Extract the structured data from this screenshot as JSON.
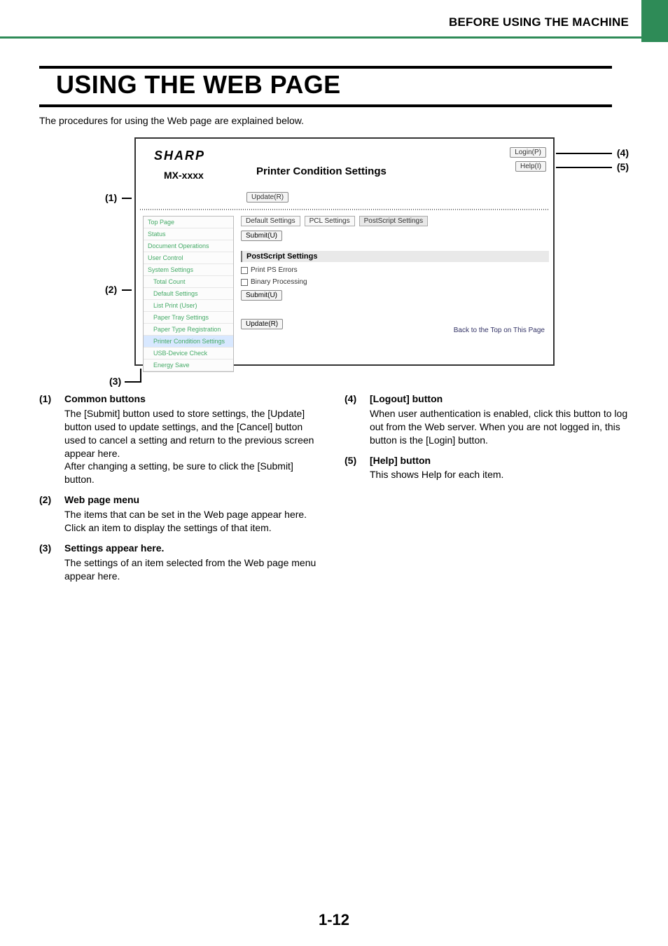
{
  "header": {
    "section": "BEFORE USING THE MACHINE"
  },
  "title": "USING THE WEB PAGE",
  "intro": "The procedures for using the Web page are explained below.",
  "callouts": {
    "c1": "(1)",
    "c2": "(2)",
    "c3": "(3)",
    "c4": "(4)",
    "c5": "(5)"
  },
  "figure": {
    "brand": "SHARP",
    "model": "MX-xxxx",
    "page_title": "Printer Condition Settings",
    "login_btn": "Login(P)",
    "help_btn": "Help(I)",
    "update_btn": "Update(R)",
    "nav": [
      "Top Page",
      "Status",
      "Document Operations",
      "User Control",
      "System Settings",
      "Total Count",
      "Default Settings",
      "List Print (User)",
      "Paper Tray Settings",
      "Paper Type Registration",
      "Printer Condition Settings",
      "USB-Device Check",
      "Energy Save"
    ],
    "tabs": {
      "t1": "Default Settings",
      "t2": "PCL Settings",
      "t3": "PostScript Settings"
    },
    "submit": "Submit(U)",
    "ps_header": "PostScript Settings",
    "opt1": "Print PS Errors",
    "opt2": "Binary Processing",
    "backtop": "Back to the Top on This Page"
  },
  "annotations": {
    "a1": {
      "num": "(1)",
      "title": "Common buttons",
      "body": "The [Submit] button used to store settings, the [Update] button used to update settings, and the [Cancel] button used to cancel a setting and return to the previous screen appear here.\nAfter changing a setting, be sure to click the [Submit] button."
    },
    "a2": {
      "num": "(2)",
      "title": "Web page menu",
      "body": "The items that can be set in the Web page appear here. Click an item to display the settings of that item."
    },
    "a3": {
      "num": "(3)",
      "title": "Settings appear here.",
      "body": "The settings of an item selected from the Web page menu appear here."
    },
    "a4": {
      "num": "(4)",
      "title": "[Logout] button",
      "body": "When user authentication is enabled, click this button to log out from the Web server. When you are not logged in, this button is the [Login] button."
    },
    "a5": {
      "num": "(5)",
      "title": "[Help] button",
      "body": "This shows Help for each item."
    }
  },
  "page_number": "1-12"
}
